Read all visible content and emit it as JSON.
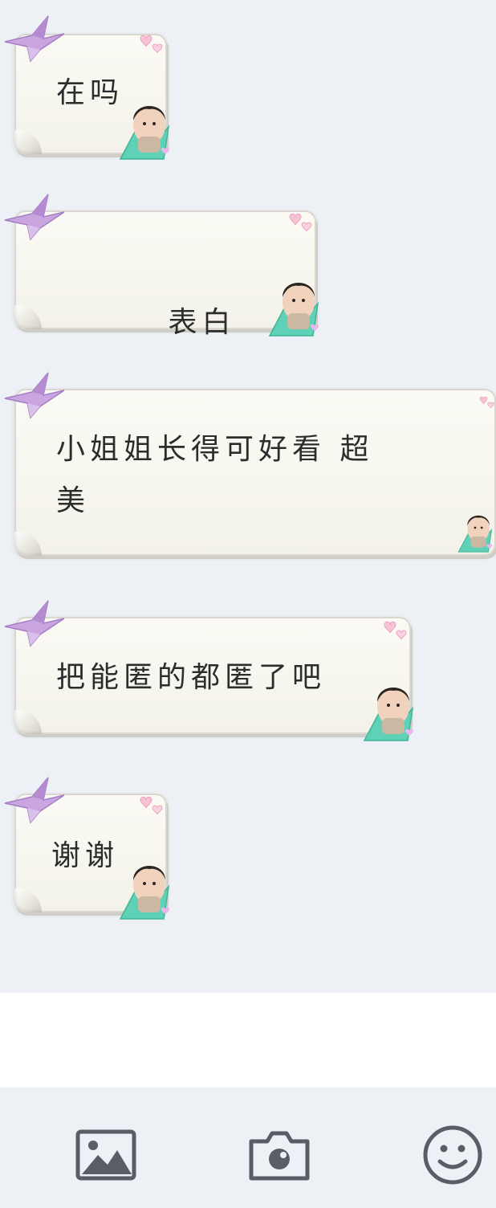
{
  "messages": [
    {
      "id": "m1",
      "text": "在吗",
      "link": ""
    },
    {
      "id": "m2",
      "text": "表白",
      "link": "20201225"
    },
    {
      "id": "m3",
      "text": "小姐姐长得可好看 超\n美",
      "link": ""
    },
    {
      "id": "m4",
      "text": "把能匿的都匿了吧",
      "link": ""
    },
    {
      "id": "m5",
      "text": "谢谢",
      "link": ""
    }
  ],
  "toolbar": {
    "items": [
      {
        "icon": "image-icon"
      },
      {
        "icon": "camera-icon"
      },
      {
        "icon": "emoji-icon"
      }
    ]
  },
  "colors": {
    "background": "#edf0f5",
    "bubble": "#f8f7f0",
    "text": "#2c2c2c",
    "link": "#1d3a7a",
    "icon": "#5a5d66",
    "crane": "#c9a6df",
    "sticker_crane": "#5fd1b6"
  }
}
